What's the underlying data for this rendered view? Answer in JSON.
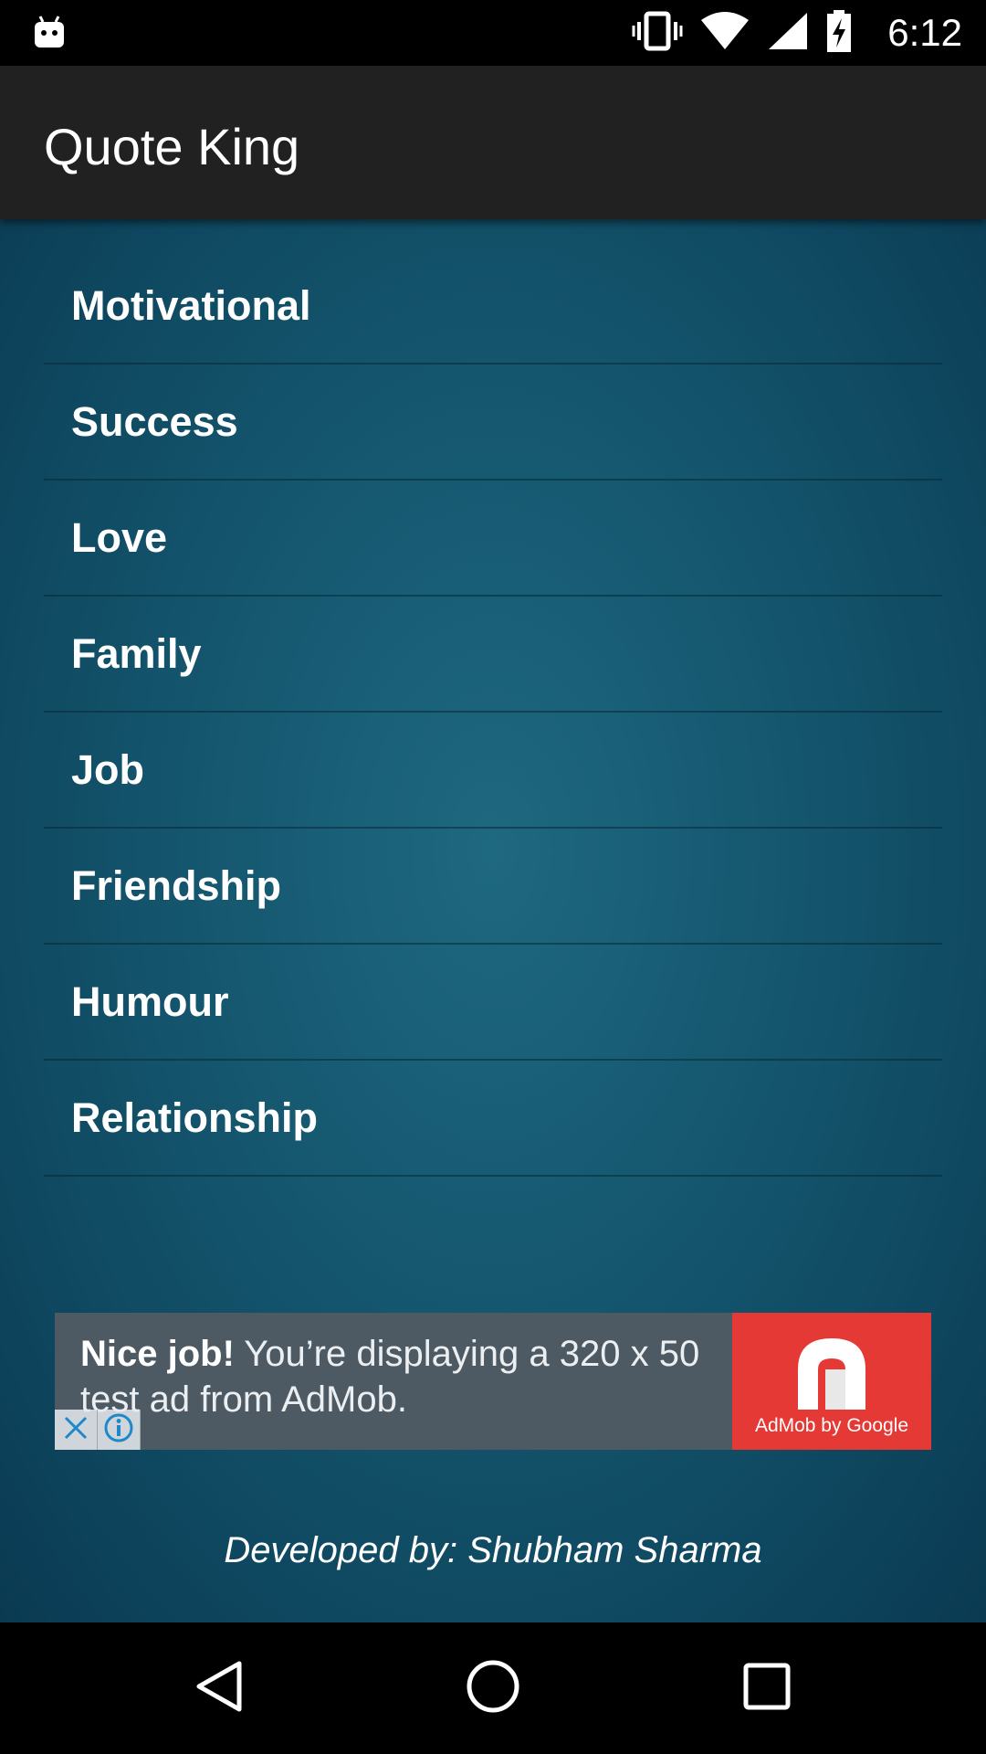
{
  "status_bar": {
    "time": "6:12",
    "icons": [
      "android-debug-icon",
      "vibrate-icon",
      "wifi-icon",
      "signal-icon",
      "battery-charging-icon"
    ]
  },
  "app_bar": {
    "title": "Quote King"
  },
  "categories": [
    {
      "label": "Motivational"
    },
    {
      "label": "Success"
    },
    {
      "label": "Love"
    },
    {
      "label": "Family"
    },
    {
      "label": "Job"
    },
    {
      "label": "Friendship"
    },
    {
      "label": "Humour"
    },
    {
      "label": "Relationship"
    }
  ],
  "ad": {
    "bold": "Nice job!",
    "text": " You’re displaying a 320 x 50 test ad from AdMob.",
    "logo_caption": "AdMob by Google",
    "background": "#4e5a63",
    "logo_background": "#e53935"
  },
  "footer": {
    "credit": "Developed by: Shubham Sharma"
  },
  "nav_bar": {
    "icons": [
      "back-icon",
      "home-icon",
      "recents-icon"
    ]
  },
  "colors": {
    "app_bar": "#212121",
    "content_bg": "#165a72"
  }
}
